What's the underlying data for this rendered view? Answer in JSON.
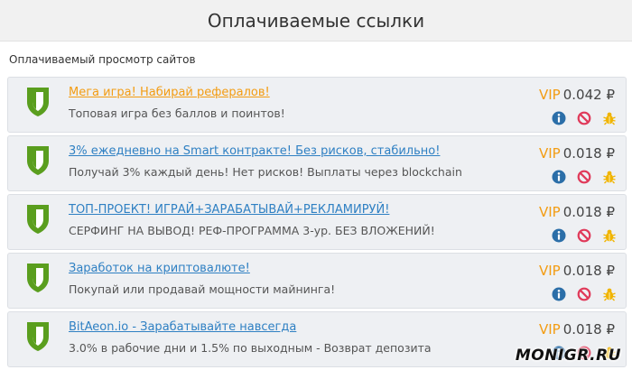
{
  "header": {
    "title": "Оплачиваемые ссылки"
  },
  "section": {
    "title": "Оплачиваемый просмотр сайтов"
  },
  "colors": {
    "shield": "#5a9e1e",
    "vip": "#f39c12",
    "link_blue": "#2f80c3",
    "link_orange": "#f39c12"
  },
  "items": [
    {
      "title": "Мега игра! Набирай рефералов!",
      "desc": "Топовая игра без баллов и поинтов!",
      "vip": "VIP",
      "price": "0.042 ₽",
      "link_style": "orange"
    },
    {
      "title": "3% ежедневно на Smart контракте! Без рисков, стабильно!",
      "desc": "Получай 3% каждый день! Нет рисков! Выплаты через blockchain",
      "vip": "VIP",
      "price": "0.018 ₽",
      "link_style": "blue"
    },
    {
      "title": "ТОП-ПРОЕКТ! ИГРАЙ+ЗАРАБАТЫВАЙ+РЕКЛАМИРУЙ!",
      "desc": "СЕРФИНГ НА ВЫВОД! РЕФ-ПРОГРАММА 3-ур. БЕЗ ВЛОЖЕНИЙ!",
      "vip": "VIP",
      "price": "0.018 ₽",
      "link_style": "blue"
    },
    {
      "title": "Заработок на криптовалюте!",
      "desc": "Покупай или продавай мощности майнинга!",
      "vip": "VIP",
      "price": "0.018 ₽",
      "link_style": "blue"
    },
    {
      "title": "BitAeon.io - Зарабатывайте навсегда",
      "desc": "3.0% в рабочие дни и 1.5% по выходным - Возврат депозита",
      "vip": "VIP",
      "price": "0.018 ₽",
      "link_style": "blue"
    }
  ],
  "icons": {
    "shield": "shield-icon",
    "info": "info-icon",
    "block": "block-icon",
    "report": "bug-icon"
  },
  "watermark": {
    "text": "MONIGR.RU"
  }
}
